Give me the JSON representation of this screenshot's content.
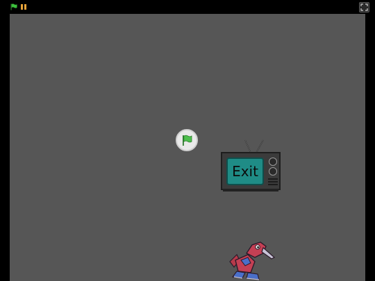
{
  "player": {
    "controls": {
      "green_flag_icon": "green-flag-icon",
      "stop_icon": "stop-icon",
      "fullscreen_icon": "fullscreen-icon"
    }
  },
  "stage": {
    "background_color": "#565656",
    "overlay_flag_icon": "green-flag-icon",
    "sprites": {
      "tv_exit": {
        "label": "Exit"
      },
      "porygon": {
        "icon": "porygon-sprite"
      }
    }
  }
}
